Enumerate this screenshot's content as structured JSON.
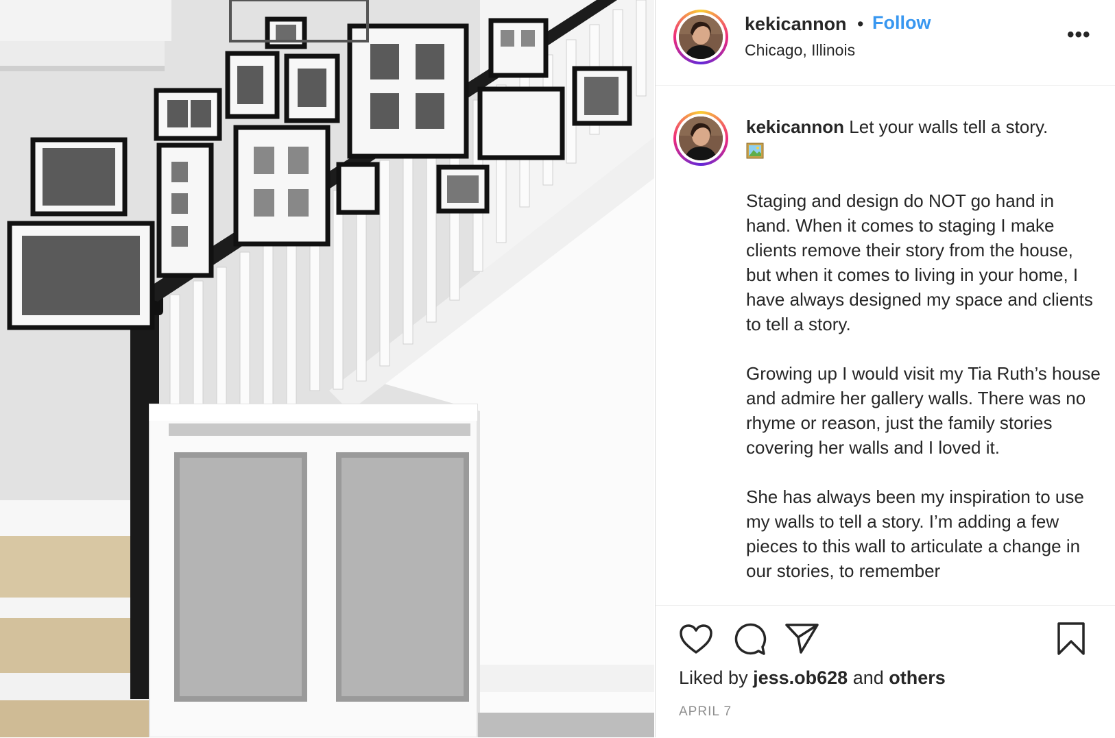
{
  "post": {
    "photo_alt": "Staircase with gallery wall",
    "author": {
      "username": "kekicannon",
      "location": "Chicago, Illinois"
    },
    "header": {
      "separator": "•",
      "follow_label": "Follow",
      "more_label": "•••"
    },
    "caption": {
      "username": "kekicannon",
      "first_line": "Let your walls tell a story.",
      "emoji_icon": "framed-picture-icon",
      "paragraphs": [
        "Staging and design do NOT go hand in hand. When it comes to staging I make clients remove their story from the house, but when it comes to living in your home, I have always designed my space and clients to tell a story.",
        "Growing up I would visit my Tia Ruth’s house and admire her gallery walls. There was no rhyme or reason, just the family stories covering her walls and I loved it.",
        "She has always been my inspiration to use my walls to tell a story. I’m adding a few pieces to this wall to articulate a change in our stories, to remember"
      ]
    },
    "actions": {
      "icons": [
        "heart-icon",
        "comment-icon",
        "share-icon",
        "bookmark-icon"
      ]
    },
    "likes": {
      "prefix": "Liked by",
      "liker": "jess.ob628",
      "middle": "and",
      "others": "others"
    },
    "date": "APRIL 7"
  },
  "colors": {
    "link_blue": "#3897f0",
    "text": "#262626",
    "muted": "#8e8e8e",
    "border": "#dbdbdb"
  }
}
